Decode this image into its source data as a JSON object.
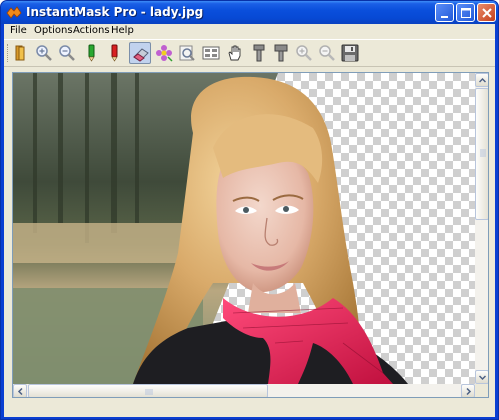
{
  "window": {
    "title": "InstantMask Pro - lady.jpg",
    "controls": [
      "minimize-icon",
      "maximize-icon",
      "close-icon"
    ]
  },
  "menu": {
    "items": [
      "File",
      "Options",
      "Actions",
      "Help"
    ]
  },
  "toolbar": {
    "tools": [
      {
        "name": "open-folder-icon"
      },
      {
        "name": "zoom-in-icon"
      },
      {
        "name": "zoom-out-icon"
      },
      {
        "name": "green-keep-marker-icon"
      },
      {
        "name": "red-drop-marker-icon"
      },
      {
        "name": "eraser-icon",
        "active": true
      },
      {
        "name": "flower-magic-icon"
      },
      {
        "name": "preview-icon"
      },
      {
        "name": "split-view-icon"
      },
      {
        "name": "hand-pan-icon"
      },
      {
        "name": "brush-small-icon"
      },
      {
        "name": "brush-large-icon"
      },
      {
        "name": "zoom-in-disabled-icon"
      },
      {
        "name": "zoom-out-disabled-icon"
      },
      {
        "name": "save-icon"
      }
    ]
  },
  "canvas": {
    "image": "photo of a blonde woman with a pink scarf, background partially masked to transparency",
    "transparency_pattern": "checkerboard"
  },
  "scrollbars": {
    "vertical": {
      "thumb_position": 0.35
    },
    "horizontal": {
      "thumb_position": 0.0
    }
  },
  "colors": {
    "titlebar": "#0a4fdc",
    "face": "#ece9d8",
    "scarf": "#e0205a",
    "hair": "#d9aa6a"
  }
}
